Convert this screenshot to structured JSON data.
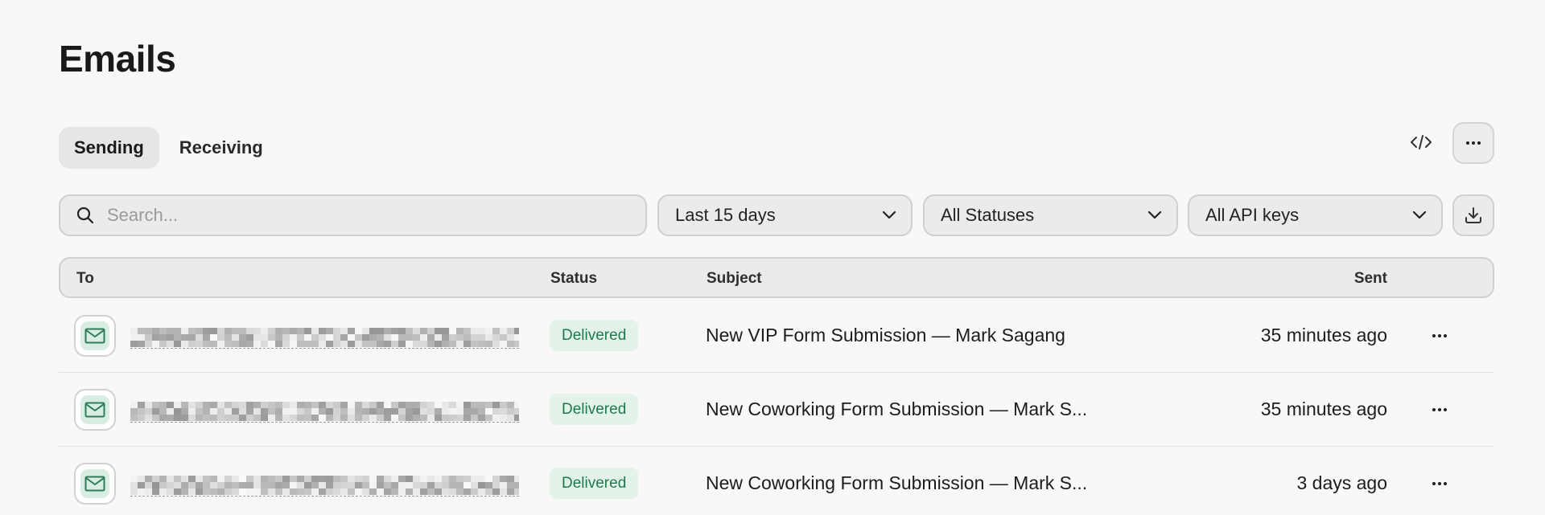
{
  "page": {
    "title": "Emails"
  },
  "tabs": [
    {
      "label": "Sending",
      "active": true
    },
    {
      "label": "Receiving",
      "active": false
    }
  ],
  "toolbar": {
    "code_icon": "code-icon",
    "more_icon": "more-horizontal-icon"
  },
  "filters": {
    "search_placeholder": "Search...",
    "date_range": "Last 15 days",
    "status": "All Statuses",
    "api_keys": "All API keys",
    "download_icon": "download-icon"
  },
  "table": {
    "columns": {
      "to": "To",
      "status": "Status",
      "subject": "Subject",
      "sent": "Sent"
    },
    "rows": [
      {
        "status": "Delivered",
        "subject": "New VIP Form Submission — Mark Sagang",
        "sent": "35 minutes ago"
      },
      {
        "status": "Delivered",
        "subject": "New Coworking Form Submission — Mark S...",
        "sent": "35 minutes ago"
      },
      {
        "status": "Delivered",
        "subject": "New Coworking Form Submission — Mark S...",
        "sent": "3 days ago"
      }
    ]
  },
  "colors": {
    "background": "#f8f8f8",
    "badge_bg": "#e3f3ea",
    "badge_text": "#1f7a4b",
    "icon_bg": "#d8eee3",
    "icon_stroke": "#2f7d57"
  }
}
